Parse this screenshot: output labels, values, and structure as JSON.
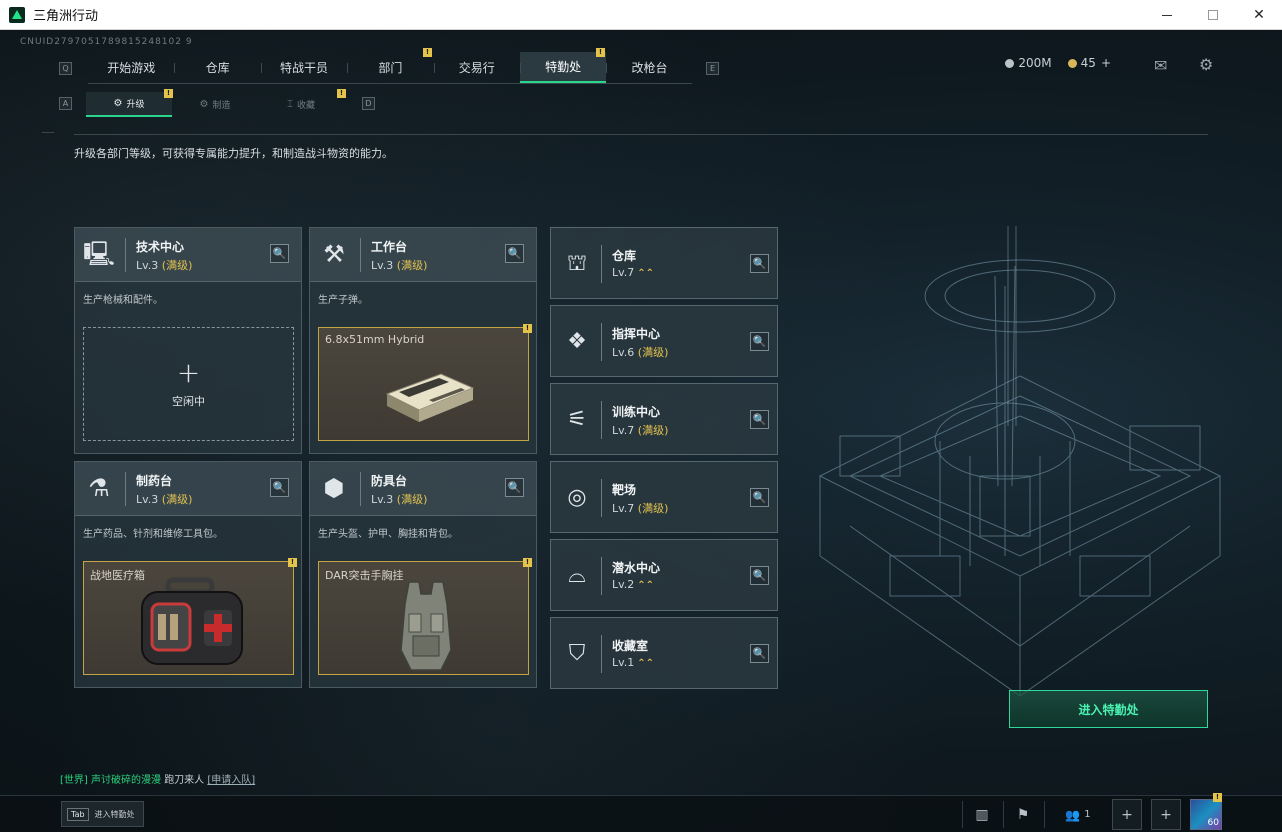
{
  "window": {
    "title": "三角洲行动",
    "minimize_label": "",
    "maximize_label": "",
    "close_label": "✕"
  },
  "uid": "CNUID2797051789815248102 9",
  "hints": {
    "left": "Q",
    "right": "E",
    "sub_left": "A",
    "sub_right": "D"
  },
  "top_tabs": [
    {
      "label": "开始游戏"
    },
    {
      "label": "仓库"
    },
    {
      "label": "特战干员"
    },
    {
      "label": "部门"
    },
    {
      "label": "交易行"
    },
    {
      "label": "特勤处"
    },
    {
      "label": "改枪台"
    }
  ],
  "sub_tabs": [
    {
      "label": "升级",
      "icon": "⚙"
    },
    {
      "label": "制造",
      "icon": "⚙"
    },
    {
      "label": "收藏",
      "icon": "⌶"
    }
  ],
  "resources": {
    "currency": "200M",
    "coins": "45",
    "coins_plus": "+"
  },
  "alert_mark": "!",
  "description": "升级各部门等级，可获得专属能力提升，和制造战斗物资的能力。",
  "large_cards": [
    {
      "name": "技术中心",
      "level": "Lv.3",
      "max": "(满级)",
      "desc": "生产枪械和配件。",
      "icon": "🖳"
    },
    {
      "name": "工作台",
      "level": "Lv.3",
      "max": "(满级)",
      "desc": "生产子弹。",
      "icon": "⚒"
    },
    {
      "name": "制药台",
      "level": "Lv.3",
      "max": "(满级)",
      "desc": "生产药品、针剂和维修工具包。",
      "icon": "⚗"
    },
    {
      "name": "防具台",
      "level": "Lv.3",
      "max": "(满级)",
      "desc": "生产头盔、护甲、胸挂和背包。",
      "icon": "⬢"
    }
  ],
  "idle_slot": {
    "plus": "+",
    "label": "空闲中"
  },
  "craft_items": [
    {
      "name": "6.8x51mm Hybrid"
    },
    {
      "name": "战地医疗箱"
    },
    {
      "name": "DAR突击手胸挂"
    }
  ],
  "small_cards": [
    {
      "name": "仓库",
      "level": "Lv.7",
      "max": "",
      "up": "⌃⌃",
      "icon": "⛫"
    },
    {
      "name": "指挥中心",
      "level": "Lv.6",
      "max": "(满级)",
      "up": "",
      "icon": "❖"
    },
    {
      "name": "训练中心",
      "level": "Lv.7",
      "max": "(满级)",
      "up": "",
      "icon": "⚟"
    },
    {
      "name": "靶场",
      "level": "Lv.7",
      "max": "(满级)",
      "up": "",
      "icon": "◎"
    },
    {
      "name": "潜水中心",
      "level": "Lv.2",
      "max": "",
      "up": "⌃⌃",
      "icon": "⌓"
    },
    {
      "name": "收藏室",
      "level": "Lv.1",
      "max": "",
      "up": "⌃⌃",
      "icon": "⛉"
    }
  ],
  "search_icon": "🔍",
  "enter_button": "进入特勤处",
  "chat": {
    "channel": "[世界]",
    "sender": "声讨破碎的漫漫",
    "message": "跑刀来人",
    "link": "[申请入队]"
  },
  "bottom": {
    "tab_key": "Tab",
    "tab_label": "进入特勤处",
    "friends_count": "1",
    "avatar_level": "60"
  },
  "colors": {
    "accent": "#29d68c",
    "max_level": "#e1c250",
    "alert": "#e3c34a"
  }
}
